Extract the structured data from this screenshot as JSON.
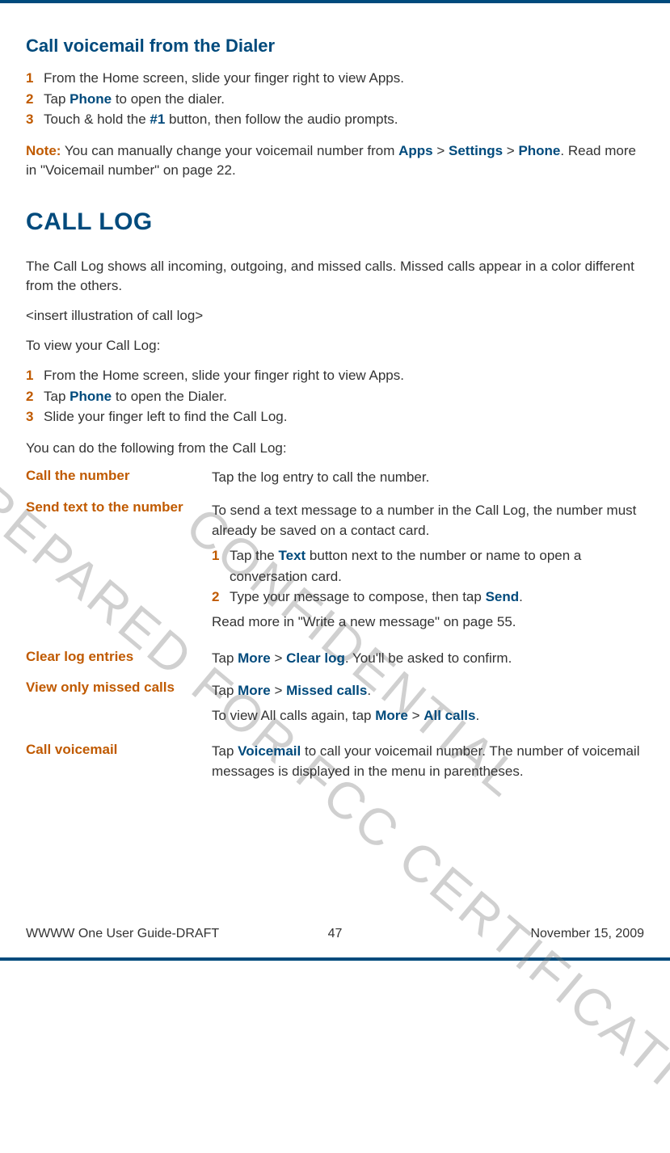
{
  "watermarks": {
    "w1": "PREPARED FOR FCC CERTIFICATION",
    "w2": "CONFIDENTIAL"
  },
  "heading_dialer": "Call voicemail from the Dialer",
  "dialer_steps": [
    {
      "n": "1",
      "pre": "From the Home screen, slide your finger right to view Apps."
    },
    {
      "n": "2",
      "pre": "Tap ",
      "link": "Phone",
      "post": " to open the dialer."
    },
    {
      "n": "3",
      "pre": "Touch & hold the ",
      "link": "#1",
      "post": " button, then follow the audio prompts."
    }
  ],
  "note": {
    "label": "Note:",
    "pre": " You can manually change your voicemail number from ",
    "l1": "Apps",
    "s1": " > ",
    "l2": "Settings",
    "s2": " > ",
    "l3": "Phone",
    "post": ". Read more in \"Voicemail number\" on page 22."
  },
  "heading_log": "CALL LOG",
  "log_intro": "The Call Log shows all incoming, outgoing, and missed calls. Missed calls appear in a color different from the others.",
  "log_placeholder": "<insert illustration of call log>",
  "log_toview": "To view your Call Log:",
  "log_steps": [
    {
      "n": "1",
      "pre": "From the Home screen, slide your finger right to view Apps."
    },
    {
      "n": "2",
      "pre": "Tap ",
      "link": "Phone",
      "post": " to open the Dialer."
    },
    {
      "n": "3",
      "pre": "Slide your finger left to find the Call Log."
    }
  ],
  "log_cando": "You can do the following from the Call Log:",
  "actions": {
    "call_number": {
      "label": "Call the number",
      "text": "Tap the log entry to call the number."
    },
    "send_text": {
      "label": "Send text to the number",
      "intro": "To send a text message to a number in the Call Log, the number must already be saved on a contact card.",
      "steps": [
        {
          "n": "1",
          "pre": "Tap the ",
          "link": "Text",
          "post": " button next to the number or name to open a conversation card."
        },
        {
          "n": "2",
          "pre": "Type your message to compose, then tap ",
          "link": "Send",
          "post": "."
        }
      ],
      "more": "Read more in \"Write a new message\" on page 55."
    },
    "clear": {
      "label": "Clear log entries",
      "pre": "Tap ",
      "l1": "More",
      "s1": " > ",
      "l2": "Clear log",
      "post": ". You'll be asked to confirm."
    },
    "missed": {
      "label": "View only missed calls",
      "line1": {
        "pre": "Tap ",
        "l1": "More",
        "s1": " > ",
        "l2": "Missed calls",
        "post": "."
      },
      "line2": {
        "pre": "To view All calls again, tap ",
        "l1": "More",
        "s1": " > ",
        "l2": "All calls",
        "post": "."
      }
    },
    "voicemail": {
      "label": "Call voicemail",
      "pre": "Tap ",
      "l1": "Voicemail",
      "post": " to call your voicemail number. The number of voicemail messages is displayed in the menu in parentheses."
    }
  },
  "footer": {
    "left": "WWWW One User Guide-DRAFT",
    "center": "47",
    "right": "November 15, 2009"
  }
}
